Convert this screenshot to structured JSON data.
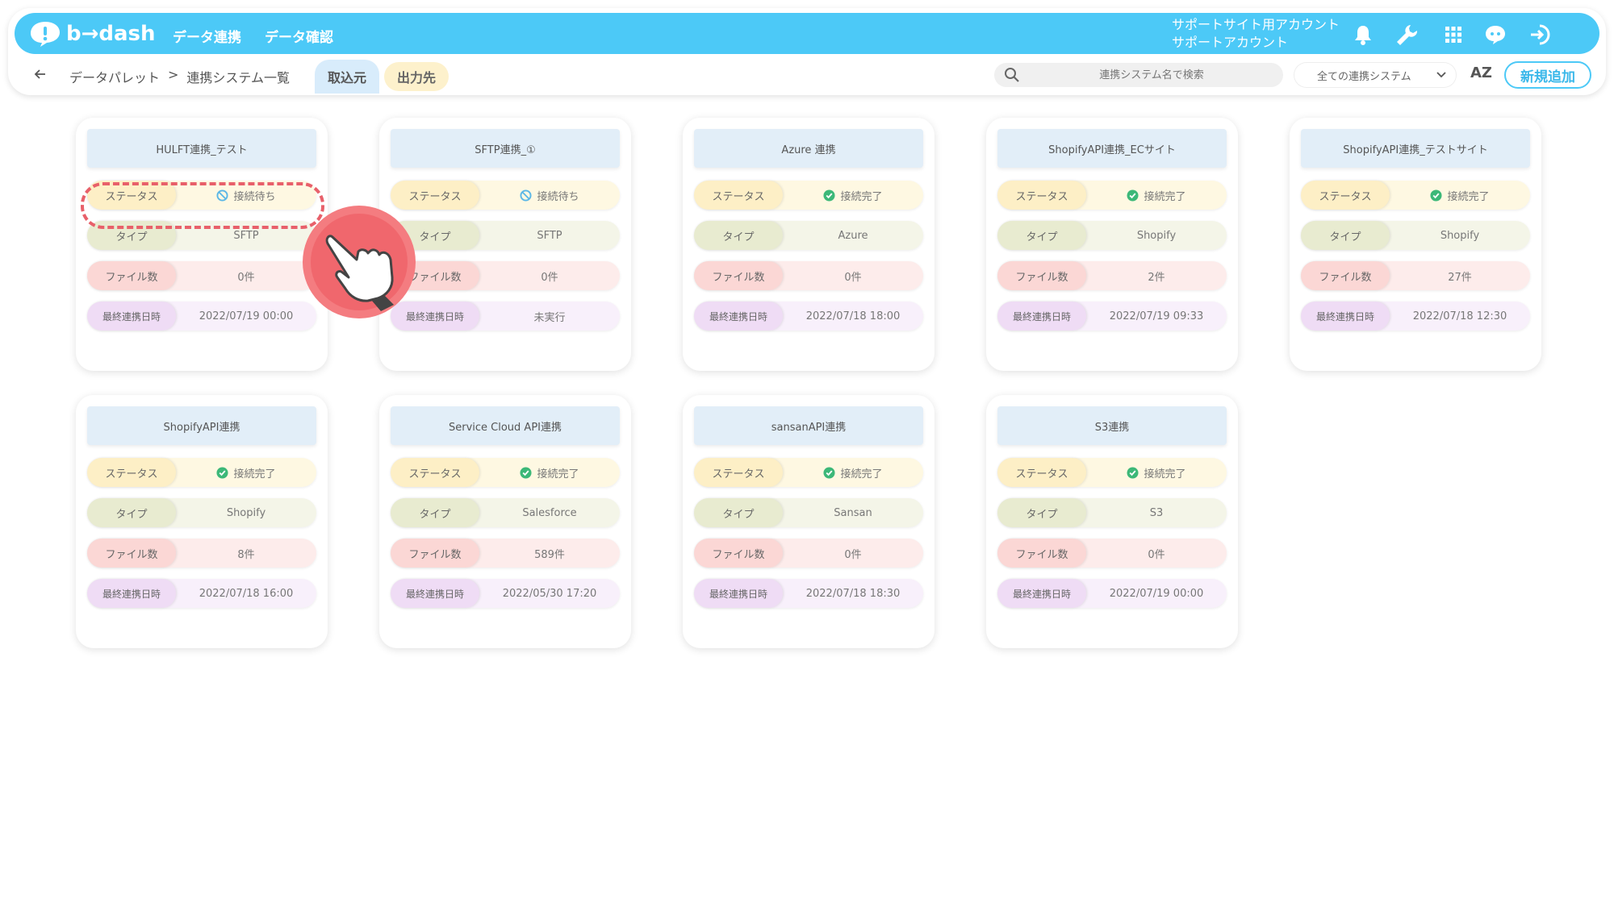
{
  "header": {
    "brand": "b→dash",
    "nav": [
      "データ連携",
      "データ確認"
    ],
    "account_line1": "サポートサイト用アカウント",
    "account_line2": "サポートアカウント",
    "icons": [
      "bell-icon",
      "wrench-icon",
      "grid-icon",
      "support-chat-icon",
      "logout-icon"
    ],
    "accent_color": "#4cc9f7"
  },
  "subbar": {
    "breadcrumb_root": "データパレット",
    "breadcrumb_sep": ">",
    "breadcrumb_current": "連携システム一覧",
    "tab_import": "取込元",
    "tab_export": "出力先",
    "search_placeholder": "連携システム名で検索",
    "filter_value": "全ての連携システム",
    "sort_label": "AZ",
    "new_button": "新規追加"
  },
  "labels": {
    "status": "ステータス",
    "type": "タイプ",
    "files": "ファイル数",
    "last_run": "最終連携日時"
  },
  "cards": [
    {
      "title": "HULFT連携_テスト",
      "status": "接続待ち",
      "status_kind": "waiting",
      "type": "SFTP",
      "files": "0件",
      "last_run": "2022/07/19 00:00"
    },
    {
      "title": "SFTP連携_①",
      "status": "接続待ち",
      "status_kind": "waiting",
      "type": "SFTP",
      "files": "0件",
      "last_run": "未実行"
    },
    {
      "title": "Azure 連携",
      "status": "接続完了",
      "status_kind": "done",
      "type": "Azure",
      "files": "0件",
      "last_run": "2022/07/18 18:00"
    },
    {
      "title": "ShopifyAPI連携_ECサイト",
      "status": "接続完了",
      "status_kind": "done",
      "type": "Shopify",
      "files": "2件",
      "last_run": "2022/07/19 09:33"
    },
    {
      "title": "ShopifyAPI連携_テストサイト",
      "status": "接続完了",
      "status_kind": "done",
      "type": "Shopify",
      "files": "27件",
      "last_run": "2022/07/18 12:30"
    },
    {
      "title": "ShopifyAPI連携",
      "status": "接続完了",
      "status_kind": "done",
      "type": "Shopify",
      "files": "8件",
      "last_run": "2022/07/18 16:00"
    },
    {
      "title": "Service Cloud API連携",
      "status": "接続完了",
      "status_kind": "done",
      "type": "Salesforce",
      "files": "589件",
      "last_run": "2022/05/30 17:20"
    },
    {
      "title": "sansanAPI連携",
      "status": "接続完了",
      "status_kind": "done",
      "type": "Sansan",
      "files": "0件",
      "last_run": "2022/07/18 18:30"
    },
    {
      "title": "S3連携",
      "status": "接続完了",
      "status_kind": "done",
      "type": "S3",
      "files": "0件",
      "last_run": "2022/07/19 00:00"
    }
  ],
  "status_colors": {
    "waiting": "#5bb7e6",
    "done": "#3cb878"
  }
}
